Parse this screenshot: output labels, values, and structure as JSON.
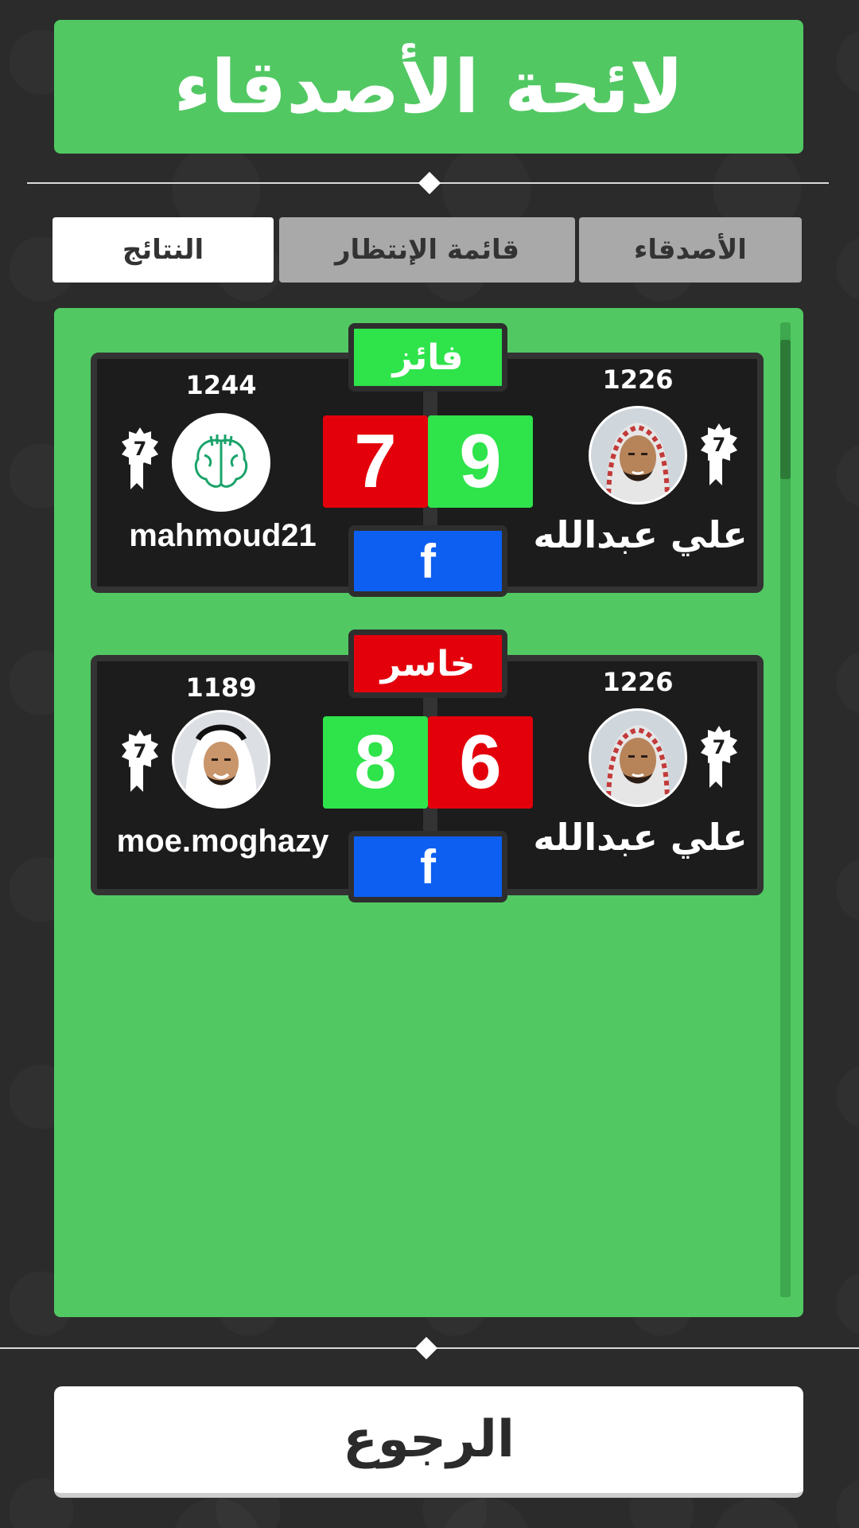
{
  "title": "لائحة الأصدقاء",
  "tabs": [
    {
      "label": "النتائج",
      "active": true
    },
    {
      "label": "قائمة الإنتظار",
      "active": false
    },
    {
      "label": "الأصدقاء",
      "active": false
    }
  ],
  "matches": [
    {
      "result_label": "فائز",
      "result_color": "#2fe34b",
      "left_player": {
        "name": "mahmoud21",
        "rating": "1244",
        "level": "7",
        "score": "7",
        "score_color": "#e3000b",
        "avatar": "brain-logo"
      },
      "right_player": {
        "name": "علي عبدالله",
        "rating": "1226",
        "level": "7",
        "score": "9",
        "score_color": "#2fe34b",
        "avatar": "man-ghutra"
      },
      "share": "f"
    },
    {
      "result_label": "خاسر",
      "result_color": "#e3000b",
      "left_player": {
        "name": "moe.moghazy",
        "rating": "1189",
        "level": "7",
        "score": "8",
        "score_color": "#2fe34b",
        "avatar": "man-white-ghutra"
      },
      "right_player": {
        "name": "علي عبدالله",
        "rating": "1226",
        "level": "7",
        "score": "6",
        "score_color": "#e3000b",
        "avatar": "man-ghutra"
      },
      "share": "f"
    }
  ],
  "back_button": "الرجوع",
  "colors": {
    "panel": "#52c863",
    "background": "#2b2b2b",
    "facebook": "#0d5ff2"
  }
}
